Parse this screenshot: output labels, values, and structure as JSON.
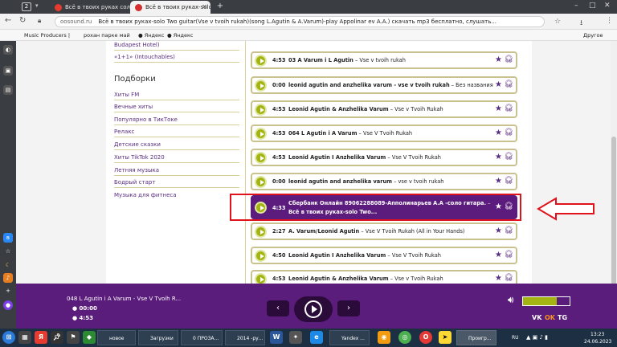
{
  "browser": {
    "tab_count": "2",
    "tabs": [
      {
        "label": "Всё в твоих руках соло 2"
      },
      {
        "label": "Всё в твоих руках-solo Tw"
      }
    ],
    "new_tab": "+",
    "address": {
      "domain": "oosound.ru",
      "title": "Всё в твоих руках-solo Two guitar(Vse v tvoih rukah)(song L.Agutin & A.Varum)-play Appolinar ev A.A.) скачать mp3 бесплатно, слушать..."
    },
    "bookmarks": [
      "Music Producers |",
      "рохан парке май",
      "Яндекс",
      "Яндекс"
    ],
    "other_bookmarks": "Другое"
  },
  "sidebar": {
    "top_item": "Budapest Hotel)",
    "links_top": [
      "«1+1» (Intouchables)"
    ],
    "heading": "Подборки",
    "links": [
      "Хиты FM",
      "Вечные хиты",
      "Популярно в ТикТоке",
      "Релакс",
      "Детские сказки",
      "Хиты TikTok 2020",
      "Летняя музыка",
      "Бодрый старт",
      "Музыка для фитнеса"
    ]
  },
  "tracks": [
    {
      "duration": "4:53",
      "artist": "03 A Varum i L Agutin",
      "title": "Vse v tvoih rukah"
    },
    {
      "duration": "0:00",
      "artist": "leonid agutin and anzhelika varum - vse v tvoih rukah",
      "title": "Без названия"
    },
    {
      "duration": "4:53",
      "artist": "Leonid Agutin & Anzhelika Varum",
      "title": "Vse v Tvoih Rukah"
    },
    {
      "duration": "4:53",
      "artist": "064 L Agutin i A Varum",
      "title": "Vse V Tvoih Rukah"
    },
    {
      "duration": "4:53",
      "artist": "Leonid Agutin I Anzhelika Varum",
      "title": "Vse V Tvoih Rukah"
    },
    {
      "duration": "0:00",
      "artist": "leonid agutin and anzhelika varum",
      "title": "vse v tvoih rukah"
    },
    {
      "duration": "4:33",
      "artist": "Сбербанк Онлайн 89062288089-Апполинарьев А.А -соло гитара.",
      "title": "Всё в твоих руках-solo Two..."
    },
    {
      "duration": "2:27",
      "artist": "A. Varum/Leonid Agutin",
      "title": "Vse V Tvoih Rukah (All in Your Hands)"
    },
    {
      "duration": "4:50",
      "artist": "Leonid Agutin I Anzhelika Varum",
      "title": "Vse V Tvoih Rukah"
    },
    {
      "duration": "4:53",
      "artist": "Leonid Agutin & Anzhelika Varum",
      "title": "Vse v Tvoih Rukah"
    }
  ],
  "player": {
    "now_playing": "048 L Agutin i A Varum - Vse V Tvoih R...",
    "elapsed": "00:00",
    "total": "4:53",
    "volume_level": 0.72,
    "social": [
      "VK",
      "OK",
      "TG"
    ]
  },
  "taskbar": {
    "items": [
      "новое",
      "Загрузки",
      "0 ПРОЗА...",
      "2014 -ру...",
      "Yandex ...",
      "Проигр..."
    ],
    "lang": "RU",
    "time": "13:23",
    "date": "24.06.2023"
  },
  "colors": {
    "brand_purple": "#5b1d7b",
    "accent_green": "#a4b513",
    "highlight": "#e0121b"
  }
}
